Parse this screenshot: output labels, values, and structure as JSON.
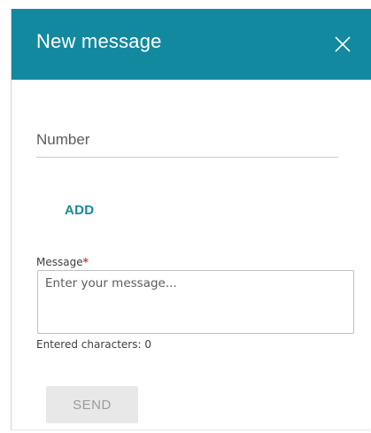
{
  "dialog": {
    "title": "New message",
    "close_icon": "close-icon",
    "number_field": {
      "placeholder": "Number",
      "value": ""
    },
    "add_label": "ADD",
    "message": {
      "label": "Message",
      "required_marker": "*",
      "placeholder": "Enter your message...",
      "value": ""
    },
    "char_count_label": "Entered characters: 0",
    "send_label": "SEND"
  },
  "colors": {
    "header_bg": "#13899f",
    "accent": "#13899f",
    "required": "#c8452b",
    "disabled_button_bg": "#e8e8e8",
    "disabled_button_text": "#9a9a9a"
  }
}
